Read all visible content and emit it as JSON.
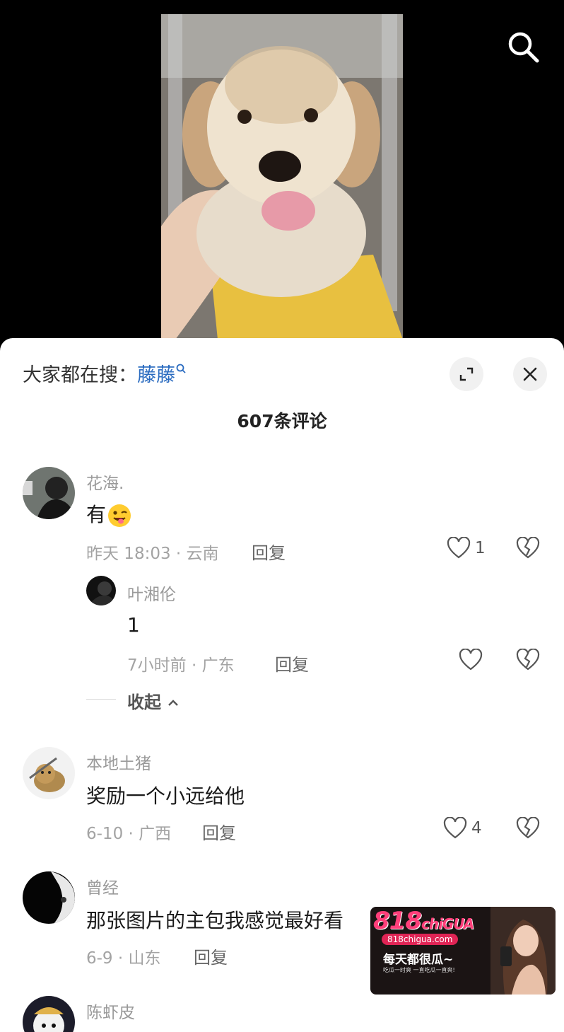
{
  "hot_search": {
    "prefix": "大家都在搜：",
    "keyword": "藤藤"
  },
  "comment_count": "607条评论",
  "comments": [
    {
      "username": "花海.",
      "text": "有",
      "time_location": "昨天 18:03 · 云南",
      "reply_label": "回复",
      "likes": "1",
      "emoji": "wink-tongue-emoji",
      "sub_replies": [
        {
          "username": "叶湘伦",
          "text": "1",
          "time_location": "7小时前 · 广东",
          "reply_label": "回复",
          "likes": ""
        }
      ],
      "collapse_label": "收起"
    },
    {
      "username": "本地土猪",
      "text": "奖励一个小远给他",
      "time_location": "6-10 · 广西",
      "reply_label": "回复",
      "likes": "4"
    },
    {
      "username": "曾经",
      "text": "那张图片的主包我感觉最好看",
      "time_location": "6-9 · 山东",
      "reply_label": "回复",
      "likes": ""
    },
    {
      "username": "陈虾皮",
      "text": "",
      "time_location": "",
      "reply_label": "",
      "likes": ""
    }
  ],
  "ad": {
    "logo_main": "818",
    "logo_sub": "chiGUA",
    "url": "818chigua.com",
    "slogan": "每天都很瓜~",
    "sub_text": "吃瓜一时爽 一直吃瓜一直爽!"
  },
  "icons": {
    "search": "search-icon",
    "expand": "expand-icon",
    "close": "close-icon",
    "like": "heart-icon",
    "dislike": "broken-heart-icon"
  },
  "colors": {
    "keyword": "#2b6cc0",
    "sheet_bg": "#ffffff",
    "ad_pink": "#ff3f7a"
  }
}
